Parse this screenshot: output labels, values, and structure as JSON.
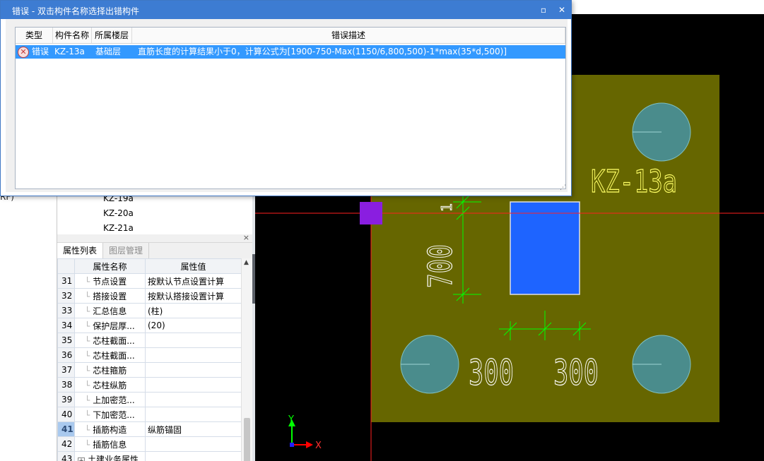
{
  "left": {
    "fragment": "RF)"
  },
  "tree": {
    "nodes": [
      "KZ-19a",
      "KZ-20a",
      "KZ-21a"
    ]
  },
  "props_panel": {
    "close": "×",
    "tabs": [
      "属性列表",
      "图层管理"
    ],
    "col_name": "属性名称",
    "col_value": "属性值",
    "rows": [
      {
        "n": "31",
        "name": "节点设置",
        "value": "按默认节点设置计算"
      },
      {
        "n": "32",
        "name": "搭接设置",
        "value": "按默认搭接设置计算"
      },
      {
        "n": "33",
        "name": "汇总信息",
        "value": "(柱)"
      },
      {
        "n": "34",
        "name": "保护层厚...",
        "value": "(20)"
      },
      {
        "n": "35",
        "name": "芯柱截面...",
        "value": ""
      },
      {
        "n": "36",
        "name": "芯柱截面...",
        "value": ""
      },
      {
        "n": "37",
        "name": "芯柱箍筋",
        "value": ""
      },
      {
        "n": "38",
        "name": "芯柱纵筋",
        "value": ""
      },
      {
        "n": "39",
        "name": "上加密范...",
        "value": ""
      },
      {
        "n": "40",
        "name": "下加密范...",
        "value": ""
      },
      {
        "n": "41",
        "name": "插筋构造",
        "value": "纵筋锚固"
      },
      {
        "n": "42",
        "name": "插筋信息",
        "value": ""
      },
      {
        "n": "43",
        "name": "土建业务属性",
        "value": ""
      }
    ],
    "selected_row": "41"
  },
  "dialog": {
    "title": "错误 - 双击构件名称选择出错构件",
    "columns": [
      "类型",
      "构件名称",
      "所属楼层",
      "错误描述"
    ],
    "error": {
      "type": "错误",
      "name": "KZ-13a",
      "floor": "基础层",
      "description": "直筋长度的计算结果小于0，计算公式为[1900-750-Max(1150/6,800,500)-1*max(35*d,500)]"
    },
    "maximize": "▫",
    "close": "✕"
  },
  "canvas": {
    "label": "KZ-13a",
    "dim_vertical": "700",
    "dim_left": "300",
    "dim_right": "300",
    "dim_top_fragment": "1",
    "axis_x": "X",
    "axis_y": "Y",
    "colors": {
      "background": "#000000",
      "pile_cap": "#666600",
      "column": "#1e64ff",
      "pile": "#4a8c8c",
      "dimension": "#00ff00",
      "text": "#ffff00",
      "crosshair": "#ff0000"
    }
  }
}
